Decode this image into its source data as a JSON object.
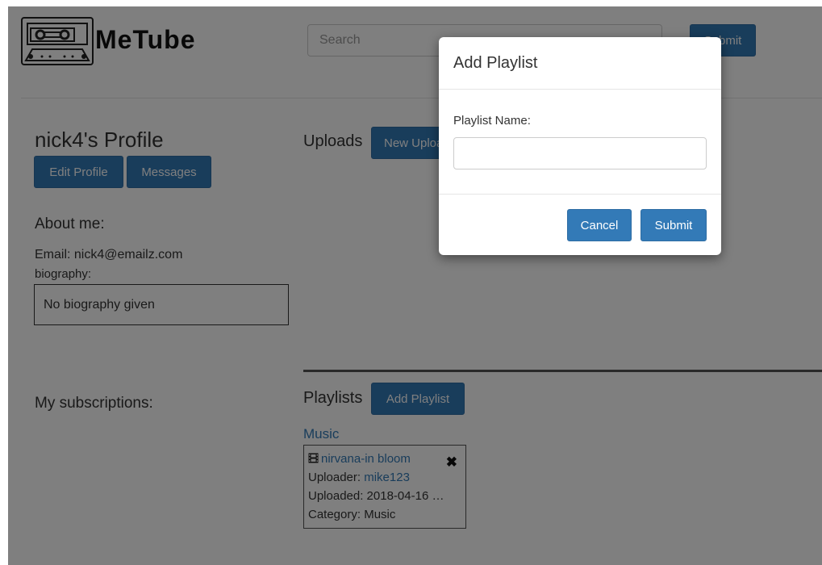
{
  "header": {
    "logo_text": "MeTube",
    "search_placeholder": "Search",
    "submit_label": "Submit"
  },
  "profile": {
    "title": "nick4's Profile",
    "edit_button": "Edit Profile",
    "messages_button": "Messages",
    "about_heading": "About me:",
    "email": "Email: nick4@emailz.com",
    "biography_label": "biography:",
    "biography_text": "No biography given",
    "subscriptions_heading": "My subscriptions:"
  },
  "uploads": {
    "heading": "Uploads",
    "new_upload_button": "New Upload"
  },
  "playlists": {
    "heading": "Playlists",
    "add_button": "Add Playlist",
    "items": [
      {
        "name": "Music",
        "videos": [
          {
            "title": "nirvana-in bloom",
            "uploader_label": "Uploader:",
            "uploader": "mike123",
            "uploaded": "Uploaded: 2018-04-16 …",
            "category": "Category: Music"
          }
        ]
      }
    ]
  },
  "modal": {
    "title": "Add Playlist",
    "field_label": "Playlist Name:",
    "field_value": "",
    "cancel_label": "Cancel",
    "submit_label": "Submit"
  },
  "icons": {
    "video": "film-icon",
    "remove": "remove-icon"
  },
  "colors": {
    "primary": "#337ab7",
    "backdrop": "rgba(0,0,0,0.5)"
  }
}
